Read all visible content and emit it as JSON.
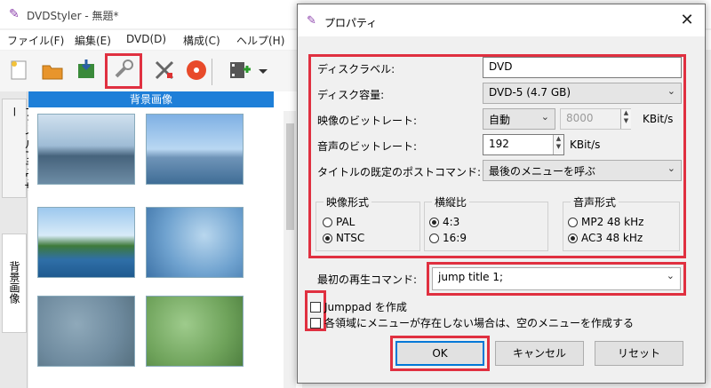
{
  "main_window": {
    "title": "DVDStyler - 無題*",
    "menu": [
      "ファイル(F)",
      "編集(E)",
      "DVD(D)",
      "構成(C)",
      "ヘルプ(H)"
    ],
    "side_tabs": {
      "files": "ファイルブラウザー",
      "backgrounds": "背景画像"
    },
    "panel_header": "背景画像"
  },
  "toolbar_icons": [
    "new-file-icon",
    "open-folder-icon",
    "save-icon",
    "properties-wrench-icon",
    "tools-icon",
    "burn-disc-icon",
    "add-video-icon"
  ],
  "dialog": {
    "title": "プロパティ",
    "disc_label_label": "ディスクラベル:",
    "disc_label_value": "DVD",
    "disc_capacity_label": "ディスク容量:",
    "disc_capacity_value": "DVD-5 (4.7 GB)",
    "video_bitrate_label": "映像のビットレート:",
    "video_bitrate_mode": "自動",
    "video_bitrate_value": "8000",
    "video_bitrate_unit": "KBit/s",
    "audio_bitrate_label": "音声のビットレート:",
    "audio_bitrate_value": "192",
    "audio_bitrate_unit": "KBit/s",
    "title_post_command_label": "タイトルの既定のポストコマンド:",
    "title_post_command_value": "最後のメニューを呼ぶ",
    "video_format": {
      "title": "映像形式",
      "options": [
        "PAL",
        "NTSC"
      ],
      "selected": "NTSC"
    },
    "aspect_ratio": {
      "title": "横縦比",
      "options": [
        "4:3",
        "16:9"
      ],
      "selected": "4:3"
    },
    "audio_format": {
      "title": "音声形式",
      "options": [
        "MP2 48 kHz",
        "AC3 48 kHz"
      ],
      "selected": "AC3 48 kHz"
    },
    "first_play_label": "最初の再生コマンド:",
    "first_play_value": "jump title 1;",
    "checkbox_jumppad": "Jumppad を作成",
    "checkbox_empty_menu": "各領域にメニューが存在しない場合は、空のメニューを作成する",
    "buttons": {
      "ok": "OK",
      "cancel": "キャンセル",
      "reset": "リセット"
    }
  },
  "colors": {
    "highlight": "#e03040",
    "accent": "#0078d7",
    "panel_header": "#1e7fd8"
  }
}
